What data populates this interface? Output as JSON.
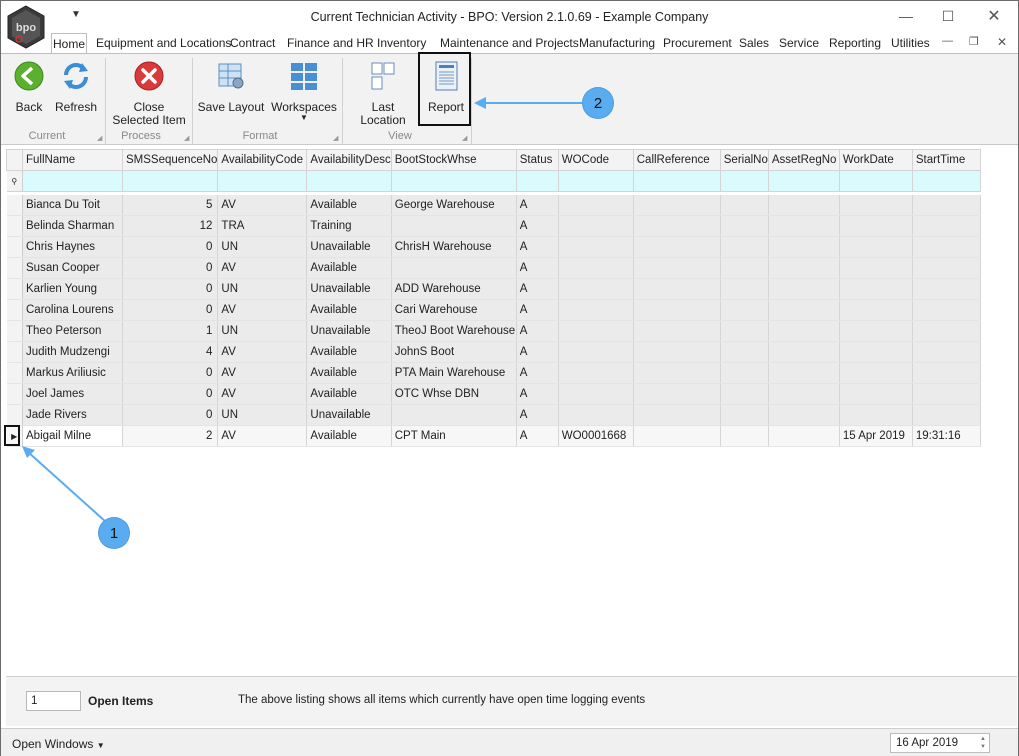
{
  "window": {
    "title": "Current Technician Activity - BPO: Version 2.1.0.69 - Example Company",
    "logo_text": "bpo"
  },
  "menu": {
    "tabs": [
      "Home",
      "Equipment and Locations",
      "Contract",
      "Finance and HR",
      "Inventory",
      "Maintenance and Projects",
      "Manufacturing",
      "Procurement",
      "Sales",
      "Service",
      "Reporting",
      "Utilities"
    ]
  },
  "ribbon": {
    "back": "Back",
    "refresh": "Refresh",
    "close_line1": "Close",
    "close_line2": "Selected Item",
    "save_layout": "Save Layout",
    "workspaces": "Workspaces",
    "last_location": "Last Location",
    "report": "Report",
    "groups": {
      "current": "Current",
      "process": "Process",
      "format": "Format",
      "view": "View"
    }
  },
  "grid": {
    "columns": [
      "FullName",
      "SMSSequenceNo",
      "AvailabilityCode",
      "AvailabilityDesc",
      "BootStockWhse",
      "Status",
      "WOCode",
      "CallReference",
      "SerialNo",
      "AssetRegNo",
      "WorkDate",
      "StartTime"
    ],
    "rows": [
      [
        "Bianca Du Toit",
        "5",
        "AV",
        "Available",
        "George Warehouse",
        "A",
        "",
        "",
        "",
        "",
        "",
        ""
      ],
      [
        "Belinda Sharman",
        "12",
        "TRA",
        "Training",
        "",
        "A",
        "",
        "",
        "",
        "",
        "",
        ""
      ],
      [
        "Chris Haynes",
        "0",
        "UN",
        "Unavailable",
        "ChrisH Warehouse",
        "A",
        "",
        "",
        "",
        "",
        "",
        ""
      ],
      [
        "Susan Cooper",
        "0",
        "AV",
        "Available",
        "",
        "A",
        "",
        "",
        "",
        "",
        "",
        ""
      ],
      [
        "Karlien  Young",
        "0",
        "UN",
        "Unavailable",
        "ADD Warehouse",
        "A",
        "",
        "",
        "",
        "",
        "",
        ""
      ],
      [
        "Carolina  Lourens",
        "0",
        "AV",
        "Available",
        "Cari Warehouse",
        "A",
        "",
        "",
        "",
        "",
        "",
        ""
      ],
      [
        "Theo Peterson",
        "1",
        "UN",
        "Unavailable",
        "TheoJ Boot Warehouse",
        "A",
        "",
        "",
        "",
        "",
        "",
        ""
      ],
      [
        "Judith Mudzengi",
        "4",
        "AV",
        "Available",
        "JohnS Boot",
        "A",
        "",
        "",
        "",
        "",
        "",
        ""
      ],
      [
        "Markus Ariliusic",
        "0",
        "AV",
        "Available",
        "PTA Main Warehouse",
        "A",
        "",
        "",
        "",
        "",
        "",
        ""
      ],
      [
        "Joel James",
        "0",
        "AV",
        "Available",
        "OTC Whse DBN",
        "A",
        "",
        "",
        "",
        "",
        "",
        ""
      ],
      [
        "Jade Rivers",
        "0",
        "UN",
        "Unavailable",
        "",
        "A",
        "",
        "",
        "",
        "",
        "",
        ""
      ],
      [
        "Abigail Milne",
        "2",
        "AV",
        "Available",
        "CPT Main",
        "A",
        "WO0001668",
        "",
        "",
        "",
        "15 Apr 2019",
        "19:31:16"
      ]
    ]
  },
  "footer": {
    "open_count": "1",
    "open_label": "Open Items",
    "note": "The above listing shows all items which currently have open time logging events"
  },
  "statusbar": {
    "open_windows": "Open Windows",
    "date": "16 Apr 2019"
  },
  "annotations": {
    "callout1": "1",
    "callout2": "2"
  },
  "colors": {
    "accent": "#5aacf0",
    "filter_row": "#dafbfd",
    "close_red": "#d93a3a",
    "back_green": "#5cb030"
  }
}
